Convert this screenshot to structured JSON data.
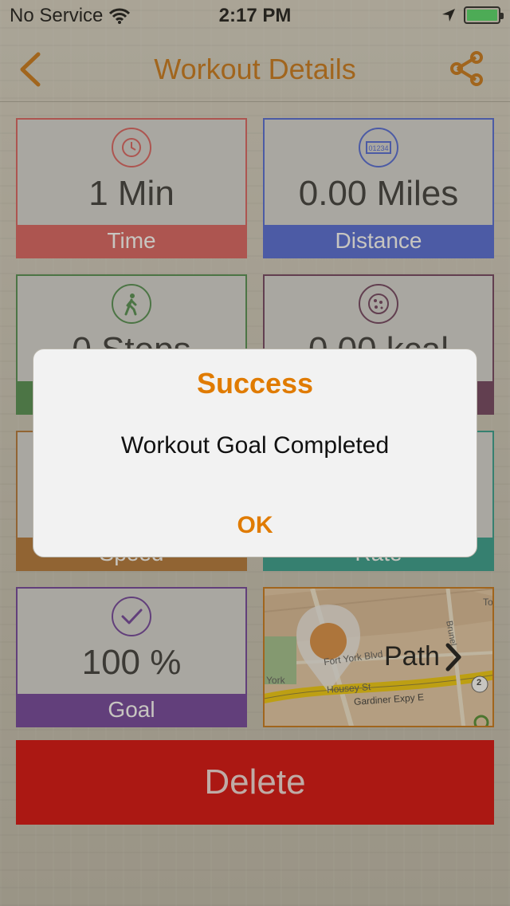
{
  "status_bar": {
    "carrier": "No Service",
    "time": "2:17 PM"
  },
  "nav": {
    "title": "Workout Details"
  },
  "tiles": [
    {
      "value": "1 Min",
      "label": "Time",
      "color": "#d95a5a",
      "icon": "clock-icon"
    },
    {
      "value": "0.00 Miles",
      "label": "Distance",
      "color": "#4a63d8",
      "icon": "odometer-icon"
    },
    {
      "value": "0 Steps",
      "label": "",
      "color": "#4a8a4a",
      "icon": "walking-icon"
    },
    {
      "value": "0.00 kcal",
      "label": "",
      "color": "#6a3a5a",
      "icon": "pizza-icon"
    },
    {
      "value": "",
      "label": "Speed",
      "color": "#b07030",
      "icon": ""
    },
    {
      "value": "",
      "label": "Rate",
      "color": "#2a9a8a",
      "icon": ""
    },
    {
      "value": "100 %",
      "label": "Goal",
      "color": "#6a3a9a",
      "icon": "checkmark-icon"
    }
  ],
  "map": {
    "label": "Path",
    "streets": [
      "Fort York Blvd",
      "Housey St",
      "Gardiner Expy E",
      "York",
      "To",
      "Brunel"
    ],
    "badge": "2"
  },
  "delete_label": "Delete",
  "alert": {
    "title": "Success",
    "message": "Workout Goal Completed",
    "button": "OK"
  }
}
